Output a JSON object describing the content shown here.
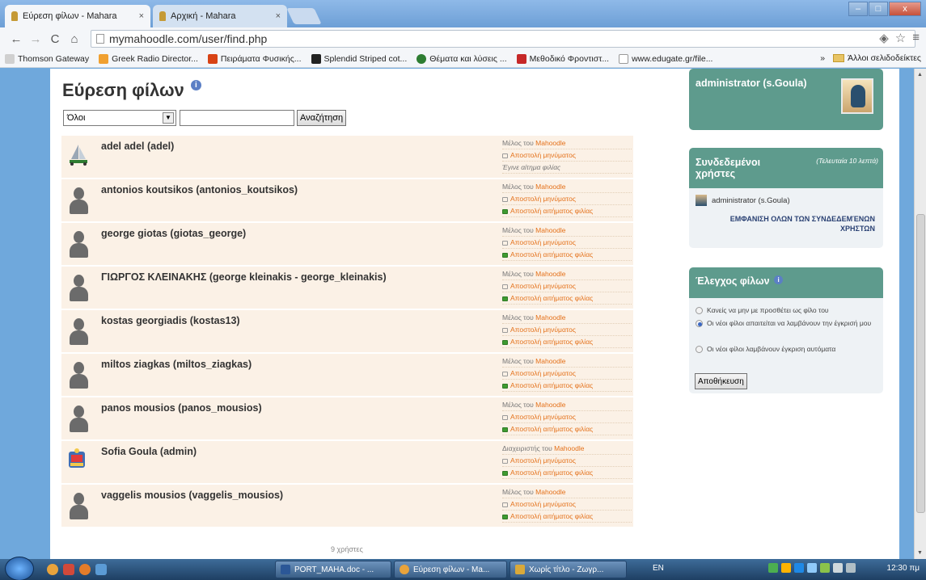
{
  "browser": {
    "tabs": [
      {
        "title": "Εύρεση φίλων - Mahara",
        "close": "×"
      },
      {
        "title": "Αρχική - Mahara",
        "close": "×"
      }
    ],
    "window_buttons": [
      "–",
      "□",
      "x"
    ],
    "url": "mymahoodle.com/user/find.php",
    "bookmarks": [
      {
        "label": "Thomson Gateway",
        "color": "#d0d0d0"
      },
      {
        "label": "Greek Radio Director...",
        "color": "#f0a030"
      },
      {
        "label": "Πειράματα Φυσικής...",
        "color": "#d84315"
      },
      {
        "label": "Splendid Striped cot...",
        "color": "#222222"
      },
      {
        "label": "Θέματα και λύσεις ...",
        "color": "#2e7d32"
      },
      {
        "label": "Μεθοδικό Φροντιστ...",
        "color": "#c62828"
      },
      {
        "label": "www.edugate.gr/file...",
        "color": "#ffffff"
      }
    ],
    "other_bookmarks": "Άλλοι σελιδοδείκτες",
    "bookmarks_overflow": "»"
  },
  "main": {
    "title": "Εύρεση φίλων",
    "filter_select": "Όλοι",
    "search_value": "",
    "search_button": "Αναζήτηση",
    "friends": [
      {
        "name": "adel adel (adel)",
        "avatar": "boat-icon",
        "role": "Μέλος του",
        "site": "Mahoodle",
        "message": "Αποστολή μηνύματος",
        "action": "Έγινε αίτημα φιλίας",
        "action_is_link": false
      },
      {
        "name": "antonios koutsikos (antonios_koutsikos)",
        "avatar": "default-user-icon",
        "role": "Μέλος του",
        "site": "Mahoodle",
        "message": "Αποστολή μηνύματος",
        "action": "Αποστολή αιτήματος φιλίας",
        "action_is_link": true
      },
      {
        "name": "george giotas (giotas_george)",
        "avatar": "default-user-icon",
        "role": "Μέλος του",
        "site": "Mahoodle",
        "message": "Αποστολή μηνύματος",
        "action": "Αποστολή αιτήματος φιλίας",
        "action_is_link": true
      },
      {
        "name": "ΓΙΩΡΓΟΣ ΚΛΕΙΝΑΚΗΣ (george kleinakis - george_kleinakis)",
        "avatar": "default-user-icon",
        "role": "Μέλος του",
        "site": "Mahoodle",
        "message": "Αποστολή μηνύματος",
        "action": "Αποστολή αιτήματος φιλίας",
        "action_is_link": true
      },
      {
        "name": "kostas georgiadis (kostas13)",
        "avatar": "default-user-icon",
        "role": "Μέλος του",
        "site": "Mahoodle",
        "message": "Αποστολή μηνύματος",
        "action": "Αποστολή αιτήματος φιλίας",
        "action_is_link": true
      },
      {
        "name": "miltos ziagkas (miltos_ziagkas)",
        "avatar": "default-user-icon",
        "role": "Μέλος του",
        "site": "Mahoodle",
        "message": "Αποστολή μηνύματος",
        "action": "Αποστολή αιτήματος φιλίας",
        "action_is_link": true
      },
      {
        "name": "panos mousios (panos_mousios)",
        "avatar": "default-user-icon",
        "role": "Μέλος του",
        "site": "Mahoodle",
        "message": "Αποστολή μηνύματος",
        "action": "Αποστολή αιτήματος φιλίας",
        "action_is_link": true
      },
      {
        "name": "Sofia Goula (admin)",
        "avatar": "admin-badge-icon",
        "role": "Διαχειριστής του",
        "site": "Mahoodle",
        "message": "Αποστολή μηνύματος",
        "action": "Αποστολή αιτήματος φιλίας",
        "action_is_link": true
      },
      {
        "name": "vaggelis mousios (vaggelis_mousios)",
        "avatar": "default-user-icon",
        "role": "Μέλος του",
        "site": "Mahoodle",
        "message": "Αποστολή μηνύματος",
        "action": "Αποστολή αιτήματος φιλίας",
        "action_is_link": true
      }
    ],
    "result_count": "9 χρήστες"
  },
  "sidebar": {
    "user_block_name": "administrator (s.Goula)",
    "online": {
      "title": "Συνδεδεμένοι χρήστες",
      "subtitle": "(Τελευταία 10 λεπτά)",
      "user": "administrator (s.Goula)",
      "show_all": "ΕΜΦΑΝΙΣΗ ΟΛΩΝ ΤΩΝ ΣΥΝΔΕΔΕΜΈΝΩΝ ΧΡΗΣΤΩΝ"
    },
    "control": {
      "title": "Έλεγχος φίλων",
      "options": [
        {
          "label": "Κανείς να μην με προσθέτει ως φίλο του",
          "checked": false
        },
        {
          "label": "Οι νέοι φίλοι απαιτείται να λαμβάνουν την έγκρισή μου",
          "checked": true
        },
        {
          "label": "Οι νέοι φίλοι λαμβάνουν έγκριση αυτόματα",
          "checked": false
        }
      ],
      "save": "Αποθήκευση"
    }
  },
  "taskbar": {
    "tasks": [
      {
        "label": "PORT_MAHA.doc - ...",
        "color": "#2b5797"
      },
      {
        "label": "Εύρεση φίλων - Ma...",
        "color": "#e8a33c"
      },
      {
        "label": "Χωρίς τίτλο - Ζωγρ...",
        "color": "#d9a93a"
      }
    ],
    "lang": "EN",
    "clock": "12:30 πμ"
  }
}
